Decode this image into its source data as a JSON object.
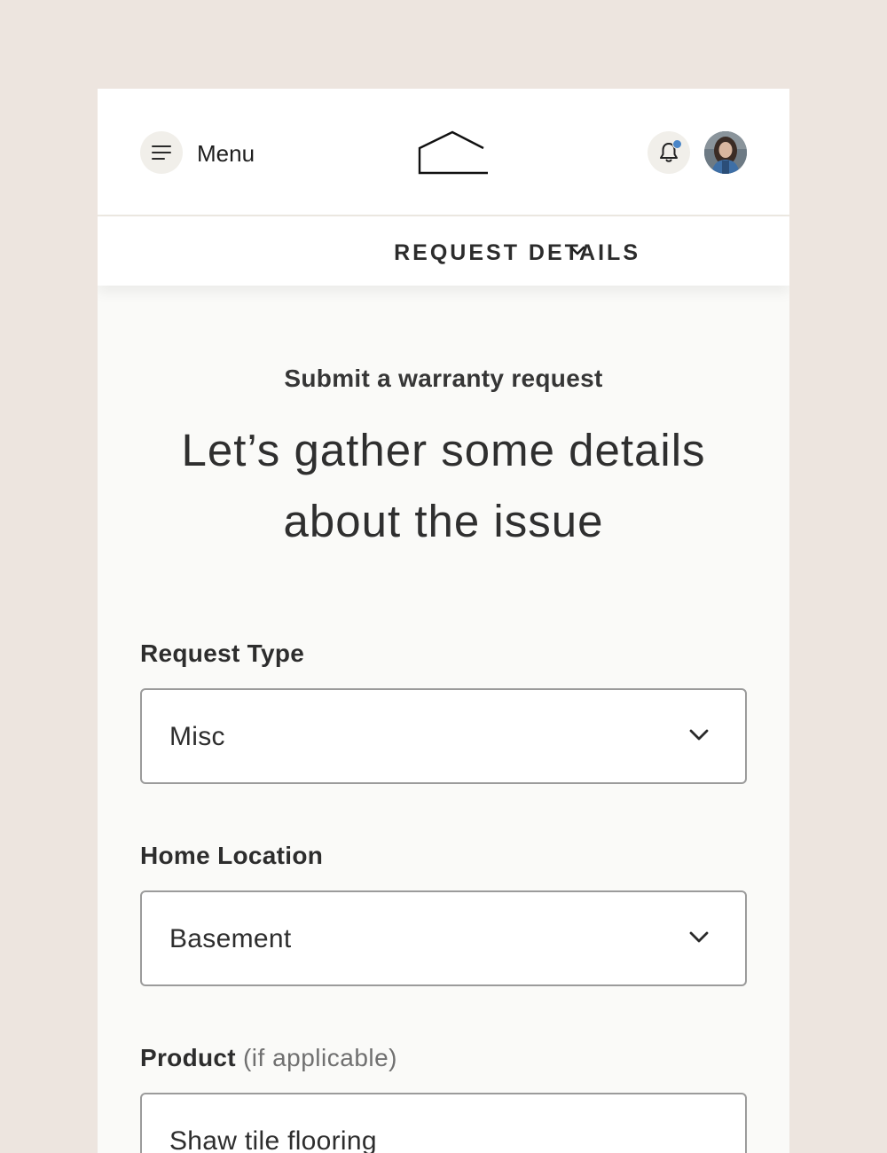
{
  "header": {
    "menu_label": "Menu",
    "notification_indicator_color": "#4a86c8",
    "icons": [
      "hamburger-icon",
      "house-logo-icon",
      "bell-icon",
      "avatar-photo"
    ]
  },
  "subnav": {
    "title": "REQUEST DETAILS",
    "icon": "chevron-down-icon"
  },
  "intro": {
    "eyebrow": "Submit a warranty request",
    "headline_line1": "Let’s gather some details",
    "headline_line2": "about the issue"
  },
  "form": {
    "request_type": {
      "label": "Request Type",
      "value": "Misc"
    },
    "home_location": {
      "label": "Home Location",
      "value": "Basement"
    },
    "product": {
      "label": "Product",
      "hint": "(if applicable)",
      "value": "Shaw tile flooring"
    }
  },
  "colors": {
    "page_background": "#ede5df",
    "card_background": "#fafaf8",
    "text": "#2f2f2f",
    "input_border": "#9b9b9b"
  }
}
